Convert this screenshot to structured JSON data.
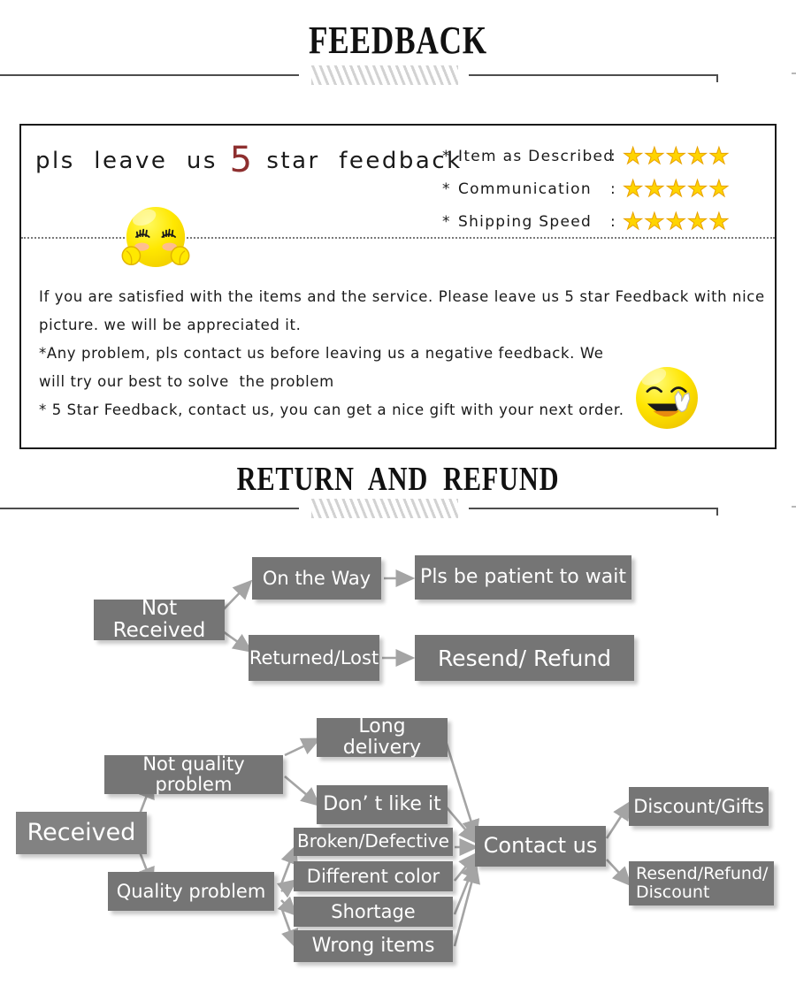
{
  "sections": {
    "feedback_title": "FEEDBACK",
    "return_title": "RETURN  AND  REFUND"
  },
  "feedback": {
    "headline_before": "pls  leave  us ",
    "headline_number": "5",
    "headline_after": " star  feedback",
    "ratings": [
      {
        "marker": "*",
        "label": "Item as Described",
        "colon": ":",
        "stars": "★★★★★",
        "count": 5
      },
      {
        "marker": "*",
        "label": "Communication",
        "colon": ":",
        "stars": "★★★★★",
        "count": 5
      },
      {
        "marker": "*",
        "label": "Shipping Speed",
        "colon": ":",
        "stars": "★★★★★",
        "count": 5
      }
    ],
    "body_lines": [
      "If you are satisfied with the items and the service. Please leave us 5 star Feedback with nice",
      "picture. we will be appreciated it.",
      "*Any problem, pls contact us before leaving us a negative feedback. We",
      "will try our best to solve  the problem",
      "* 5 Star Feedback, contact us, you can get a nice gift with your next order."
    ],
    "emoji_shy_name": "shy-face-emoji",
    "emoji_peace_name": "smiling-peace-sign-emoji"
  },
  "flow": {
    "not_received": {
      "root": "Not Received",
      "branch_on_the_way": "On the Way",
      "branch_on_the_way_result": "Pls be patient to wait",
      "branch_returned_lost": "Returned/Lost",
      "branch_returned_lost_result": "Resend/ Refund"
    },
    "received": {
      "root": "Received",
      "not_quality": "Not quality problem",
      "quality": "Quality problem",
      "not_quality_children": [
        "Long delivery",
        "Don’  t like it"
      ],
      "quality_children": [
        "Broken/Defective",
        "Different color",
        "Shortage",
        "Wrong items"
      ],
      "contact": "Contact us",
      "outcomes": [
        "Discount/Gifts",
        "Resend/Refund/\nDiscount"
      ]
    }
  },
  "colors": {
    "node_fill": "#757575",
    "node_fill_light": "#828282",
    "node_text": "#ffffff",
    "arrow": "#a0a0a0",
    "rule": "#4d4d4d",
    "hatch": "#d2d2d2",
    "star": "#ffd400",
    "star_outline": "#e8a200",
    "accent_number": "#8e2f2f",
    "panel_border": "#1a1a1a"
  }
}
